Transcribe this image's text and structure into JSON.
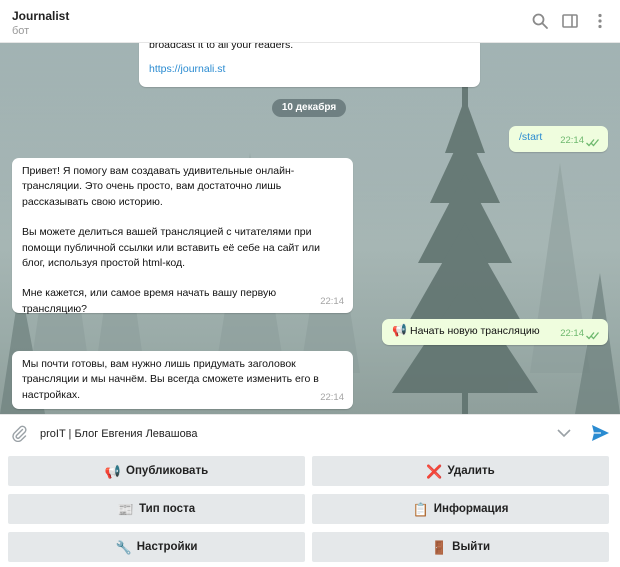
{
  "header": {
    "title": "Journalist",
    "subtitle": "бот"
  },
  "messages": {
    "welcome_tail": {
      "text": "broadcast it to all your readers.",
      "link": "https://journali.st"
    },
    "date_separator": "10 декабря",
    "start_cmd": {
      "text": "/start",
      "time": "22:14"
    },
    "greeting": {
      "p1l1": "Привет! Я помогу вам создавать удивительные онлайн-",
      "p1l2": "трансляции. Это очень просто, вам достаточно лишь",
      "p1l3": "рассказывать свою историю.",
      "p2l1": "Вы можете делиться вашей трансляцией с читателями при",
      "p2l2": "помощи публичной ссылки или вставить её себе на сайт или",
      "p2l3": "блог, используя простой html-код.",
      "p3l1": "Мне кажется, или самое время начать вашу первую",
      "p3l2": "трансляцию?",
      "time": "22:14"
    },
    "new_broadcast": {
      "emoji": "📢",
      "text": "Начать новую трансляцию",
      "time": "22:14"
    },
    "almost_ready": {
      "l1": "Мы почти готовы, вам нужно лишь придумать заголовок",
      "l2": "трансляции и мы начнём. Вы всегда сможете изменить его в",
      "l3": "настройках.",
      "time": "22:14"
    }
  },
  "input": {
    "value": "proIT | Блог Евгения Левашова"
  },
  "keyboard": {
    "publish": {
      "icon": "📢",
      "label": "Опубликовать"
    },
    "delete": {
      "icon": "❌",
      "label": "Удалить"
    },
    "post_type": {
      "icon": "📰",
      "label": "Тип поста"
    },
    "info": {
      "icon": "📋",
      "label": "Информация"
    },
    "settings": {
      "icon": "🔧",
      "label": "Настройки"
    },
    "exit": {
      "icon": "🚪",
      "label": "Выйти"
    }
  },
  "colors": {
    "accent": "#2a8bd1",
    "outgoing_bubble": "#effdde",
    "check_green": "#6fb96f",
    "keyboard_button": "#e5e8ea"
  }
}
